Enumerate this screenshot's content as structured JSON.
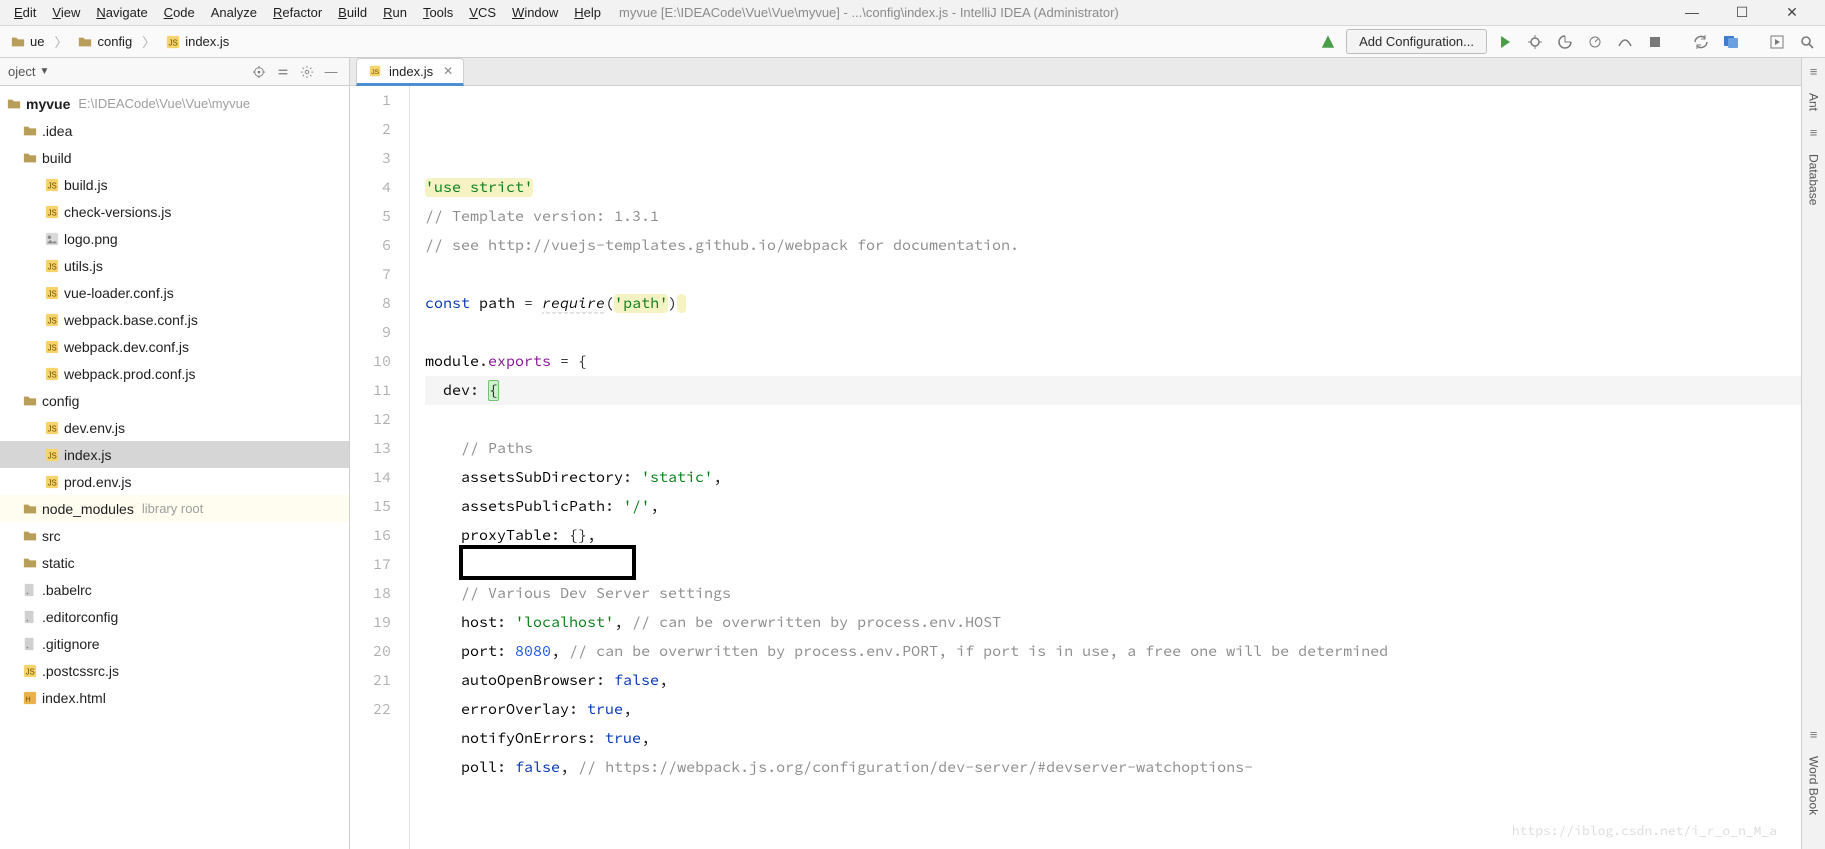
{
  "window": {
    "title": "myvue [E:\\IDEACode\\Vue\\Vue\\myvue] - ...\\config\\index.js - IntelliJ IDEA (Administrator)"
  },
  "menu": {
    "items": [
      {
        "accel": "E",
        "rest": "dit"
      },
      {
        "accel": "V",
        "rest": "iew"
      },
      {
        "accel": "N",
        "rest": "avigate"
      },
      {
        "accel": "C",
        "rest": "ode"
      },
      {
        "label": "Analyze"
      },
      {
        "accel": "R",
        "rest": "efactor"
      },
      {
        "accel": "B",
        "rest": "uild"
      },
      {
        "accel": "R",
        "rest": "un"
      },
      {
        "accel": "T",
        "rest": "ools"
      },
      {
        "accel": "V",
        "rest": "CS"
      },
      {
        "accel": "W",
        "rest": "indow"
      },
      {
        "accel": "H",
        "rest": "elp"
      }
    ]
  },
  "breadcrumb": {
    "items": [
      {
        "kind": "folder",
        "label": "ue"
      },
      {
        "kind": "folder",
        "label": "config"
      },
      {
        "kind": "jsfile",
        "label": "index.js"
      }
    ]
  },
  "runbar": {
    "add_configuration": "Add Configuration..."
  },
  "project": {
    "header_label": "oject",
    "root_name": "myvue",
    "root_path": "E:\\IDEACode\\Vue\\Vue\\myvue",
    "tree": [
      {
        "lvl": 2,
        "icon": "folder",
        "label": ".idea"
      },
      {
        "lvl": 2,
        "icon": "folder",
        "label": "build"
      },
      {
        "lvl": 3,
        "icon": "jsfile",
        "label": "build.js"
      },
      {
        "lvl": 3,
        "icon": "jsfile",
        "label": "check-versions.js"
      },
      {
        "lvl": 3,
        "icon": "png",
        "label": "logo.png"
      },
      {
        "lvl": 3,
        "icon": "jsfile",
        "label": "utils.js"
      },
      {
        "lvl": 3,
        "icon": "jsfile",
        "label": "vue-loader.conf.js"
      },
      {
        "lvl": 3,
        "icon": "jsfile",
        "label": "webpack.base.conf.js"
      },
      {
        "lvl": 3,
        "icon": "jsfile",
        "label": "webpack.dev.conf.js"
      },
      {
        "lvl": 3,
        "icon": "jsfile",
        "label": "webpack.prod.conf.js"
      },
      {
        "lvl": 2,
        "icon": "folder",
        "label": "config"
      },
      {
        "lvl": 3,
        "icon": "jsfile",
        "label": "dev.env.js"
      },
      {
        "lvl": 3,
        "icon": "jsfile",
        "label": "index.js",
        "selected": true
      },
      {
        "lvl": 3,
        "icon": "jsfile",
        "label": "prod.env.js"
      },
      {
        "lvl": 2,
        "icon": "folder",
        "label": "node_modules",
        "sub": "library root",
        "lib": true
      },
      {
        "lvl": 2,
        "icon": "folder",
        "label": "src"
      },
      {
        "lvl": 2,
        "icon": "folder",
        "label": "static"
      },
      {
        "lvl": 2,
        "icon": "dotfile",
        "label": ".babelrc"
      },
      {
        "lvl": 2,
        "icon": "dotfile",
        "label": ".editorconfig"
      },
      {
        "lvl": 2,
        "icon": "dotfile",
        "label": ".gitignore"
      },
      {
        "lvl": 2,
        "icon": "jsfile",
        "label": ".postcssrc.js"
      },
      {
        "lvl": 2,
        "icon": "html",
        "label": "index.html"
      }
    ]
  },
  "editor": {
    "tab_label": "index.js",
    "lines": [
      {
        "n": 1,
        "segs": [
          {
            "t": "'use strict'",
            "c": "tok-str tok-str-bg"
          }
        ]
      },
      {
        "n": 2,
        "segs": [
          {
            "t": "// Template version: 1.3.1",
            "c": "tok-cmt"
          }
        ]
      },
      {
        "n": 3,
        "segs": [
          {
            "t": "// see http://vuejs-templates.github.io/webpack for documentation.",
            "c": "tok-cmt"
          }
        ]
      },
      {
        "n": 4,
        "segs": []
      },
      {
        "n": 5,
        "segs": [
          {
            "t": "const ",
            "c": "tok-kw"
          },
          {
            "t": "path",
            "c": "tok-id"
          },
          {
            "t": " = "
          },
          {
            "t": "require",
            "c": "tok-fn tok-squig"
          },
          {
            "t": "("
          },
          {
            "t": "'path'",
            "c": "tok-str tok-str-bg"
          },
          {
            "t": ")"
          },
          {
            "t": " ",
            "c": "tok-str-bg"
          }
        ]
      },
      {
        "n": 6,
        "segs": []
      },
      {
        "n": 7,
        "segs": [
          {
            "t": "module",
            "c": "tok-id"
          },
          {
            "t": "."
          },
          {
            "t": "exports",
            "c": "tok-prop"
          },
          {
            "t": " = {"
          }
        ]
      },
      {
        "n": 8,
        "hl": true,
        "indent": 1,
        "segs": [
          {
            "t": "dev",
            "c": "tok-id"
          },
          {
            "t": ": "
          },
          {
            "t": "{",
            "c": "bracket-hl"
          },
          {
            "caret": true
          }
        ]
      },
      {
        "n": 9,
        "segs": []
      },
      {
        "n": 10,
        "indent": 2,
        "segs": [
          {
            "t": "// Paths",
            "c": "tok-cmt"
          }
        ]
      },
      {
        "n": 11,
        "indent": 2,
        "segs": [
          {
            "t": "assetsSubDirectory",
            "c": "tok-id"
          },
          {
            "t": ": "
          },
          {
            "t": "'static'",
            "c": "tok-str"
          },
          {
            "t": ","
          }
        ]
      },
      {
        "n": 12,
        "indent": 2,
        "segs": [
          {
            "t": "assetsPublicPath",
            "c": "tok-id"
          },
          {
            "t": ": "
          },
          {
            "t": "'/'",
            "c": "tok-str"
          },
          {
            "t": ","
          }
        ]
      },
      {
        "n": 13,
        "indent": 2,
        "segs": [
          {
            "t": "proxyTable",
            "c": "tok-id"
          },
          {
            "t": ": {},"
          }
        ]
      },
      {
        "n": 14,
        "segs": []
      },
      {
        "n": 15,
        "indent": 2,
        "segs": [
          {
            "t": "// Various Dev Server settings",
            "c": "tok-cmt"
          }
        ]
      },
      {
        "n": 16,
        "indent": 2,
        "segs": [
          {
            "t": "host",
            "c": "tok-id"
          },
          {
            "t": ": "
          },
          {
            "t": "'localhost'",
            "c": "tok-str"
          },
          {
            "t": ", "
          },
          {
            "t": "// can be overwritten by process.env.HOST",
            "c": "tok-cmt"
          }
        ]
      },
      {
        "n": 17,
        "indent": 2,
        "segs": [
          {
            "t": "port",
            "c": "tok-id"
          },
          {
            "t": ": "
          },
          {
            "t": "8080",
            "c": "tok-num"
          },
          {
            "t": ", "
          },
          {
            "t": "// can be overwritten by process.env.PORT, if port is in use, a free one will be determined",
            "c": "tok-cmt"
          }
        ]
      },
      {
        "n": 18,
        "indent": 2,
        "segs": [
          {
            "t": "autoOpenBrowser",
            "c": "tok-id"
          },
          {
            "t": ": "
          },
          {
            "t": "false",
            "c": "tok-kw"
          },
          {
            "t": ","
          }
        ]
      },
      {
        "n": 19,
        "indent": 2,
        "segs": [
          {
            "t": "errorOverlay",
            "c": "tok-id"
          },
          {
            "t": ": "
          },
          {
            "t": "true",
            "c": "tok-kw"
          },
          {
            "t": ","
          }
        ]
      },
      {
        "n": 20,
        "indent": 2,
        "segs": [
          {
            "t": "notifyOnErrors",
            "c": "tok-id"
          },
          {
            "t": ": "
          },
          {
            "t": "true",
            "c": "tok-kw"
          },
          {
            "t": ","
          }
        ]
      },
      {
        "n": 21,
        "indent": 2,
        "segs": [
          {
            "t": "poll",
            "c": "tok-id"
          },
          {
            "t": ": "
          },
          {
            "t": "false",
            "c": "tok-kw"
          },
          {
            "t": ", "
          },
          {
            "t": "// https://webpack.js.org/configuration/dev-server/#devserver-watchoptions-",
            "c": "tok-cmt"
          }
        ]
      },
      {
        "n": 22,
        "segs": []
      }
    ]
  },
  "rightStrip": {
    "labels": [
      "Ant",
      "Database",
      "Word Book"
    ]
  },
  "watermark": "https://iblog.csdn.net/i_r_o_n_M_a"
}
